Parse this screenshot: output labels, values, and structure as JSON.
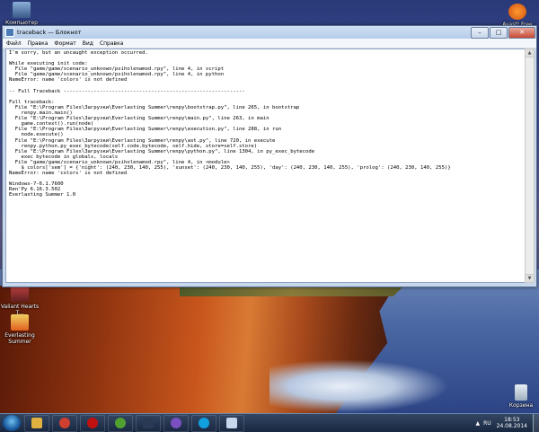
{
  "desktop": {
    "icons": [
      {
        "label": "Компьютер"
      },
      {
        "label": "Avast! Free"
      },
      {
        "label": "Valiant Hearts T..."
      },
      {
        "label": "Everlasting Summer"
      },
      {
        "label": "Корзина"
      }
    ]
  },
  "window": {
    "title": "traceback — Блокнот",
    "controls": {
      "minimize": "–",
      "maximize": "□",
      "close": "✕"
    },
    "menu": [
      "Файл",
      "Правка",
      "Формат",
      "Вид",
      "Справка"
    ],
    "content": [
      "I'm sorry, but an uncaught exception occurred.",
      "",
      "While executing init code:",
      "  File \"game/game/scenario_unknown/psiholenamod.rpy\", line 4, in script",
      "  File \"game/game/scenario_unknown/psiholenamod.rpy\", line 4, in python",
      "NameError: name 'colors' is not defined",
      "",
      "-- Full Traceback ------------------------------------------------------------",
      "",
      "Full traceback:",
      "  File \"E:\\Program Files\\Загрузки\\Everlasting Summer\\renpy\\bootstrap.py\", line 265, in bootstrap",
      "    renpy.main.main()",
      "  File \"E:\\Program Files\\Загрузки\\Everlasting Summer\\renpy\\main.py\", line 263, in main",
      "    game.context().run(node)",
      "  File \"E:\\Program Files\\Загрузки\\Everlasting Summer\\renpy\\execution.py\", line 288, in run",
      "    node.execute()",
      "  File \"E:\\Program Files\\Загрузки\\Everlasting Summer\\renpy\\ast.py\", line 720, in execute",
      "    renpy.python.py_exec_bytecode(self.code.bytecode, self.hide, store=self.store)",
      "  File \"E:\\Program Files\\Загрузки\\Everlasting Summer\\renpy\\python.py\", line 1304, in py_exec_bytecode",
      "    exec bytecode in globals, locals",
      "  File \"game/game/scenario_unknown/psiholenamod.rpy\", line 4, in <module>",
      "    $ colors['sem'] = {'night': (240, 230, 140, 255), 'sunset': (240, 230, 140, 255), 'day': (240, 230, 140, 255), 'prolog': (240, 230, 140, 255)}",
      "NameError: name 'colors' is not defined",
      "",
      "Windows-7-6.1.7600",
      "Ren'Py 6.16.3.502",
      "Everlasting Summer 1.0"
    ]
  },
  "taskbar": {
    "apps": [
      {
        "icon": "explorer-icon",
        "color": "#e0b040"
      },
      {
        "icon": "chrome-icon",
        "color": "#d04030"
      },
      {
        "icon": "opera-icon",
        "color": "#c01010"
      },
      {
        "icon": "utorrent-icon",
        "color": "#50a030"
      },
      {
        "icon": "steam-icon",
        "color": "#2a3a55"
      },
      {
        "icon": "viber-icon",
        "color": "#7a50c0"
      },
      {
        "icon": "skype-icon",
        "color": "#10a0e0"
      },
      {
        "icon": "notepad-icon",
        "color": "#c8d8ec"
      }
    ],
    "tray": {
      "arrow": "▲",
      "lang": "RU",
      "time": "18:53",
      "date": "24.08.2014"
    }
  }
}
